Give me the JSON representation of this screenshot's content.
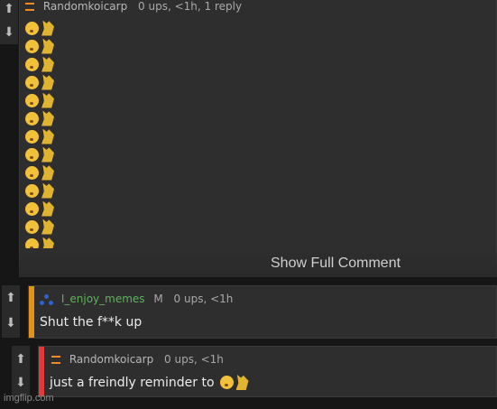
{
  "comment1": {
    "author": "Randomkoicarp",
    "stats": "0 ups, <1h, 1 reply",
    "show_full": "Show Full Comment",
    "emoji_rows": 14
  },
  "comment2": {
    "author": "I_enjoy_memes",
    "mod_badge": "M",
    "stats": "0 ups, <1h",
    "text": "Shut the f**k up",
    "accent": "#e69118"
  },
  "comment3": {
    "author": "Randomkoicarp",
    "stats": "0 ups, <1h",
    "text": "just a freindly reminder to",
    "accent": "#e03a3a"
  },
  "icons": {
    "upvote": "up-arrow-icon",
    "downvote": "down-arrow-icon",
    "flair": "flag-icon"
  },
  "watermark": "imgflip.com"
}
